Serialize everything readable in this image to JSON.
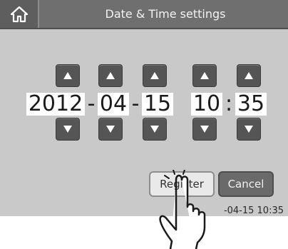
{
  "header": {
    "title": "Date & Time settings",
    "home_icon": "home-icon"
  },
  "datetime": {
    "year": "2012",
    "month": "04",
    "day": "15",
    "hour": "10",
    "minute": "35",
    "date_separator": "-",
    "time_separator": ":"
  },
  "buttons": {
    "register": "Register",
    "cancel": "Cancel"
  },
  "status": {
    "current_datetime": "-04-15 10:35"
  },
  "colors": {
    "background": "#c9c9c9",
    "titlebar": "#6f6f6f",
    "arrow_button": "#555555",
    "register_button": "#e9e9e9",
    "cancel_button": "#6a6a6a"
  }
}
